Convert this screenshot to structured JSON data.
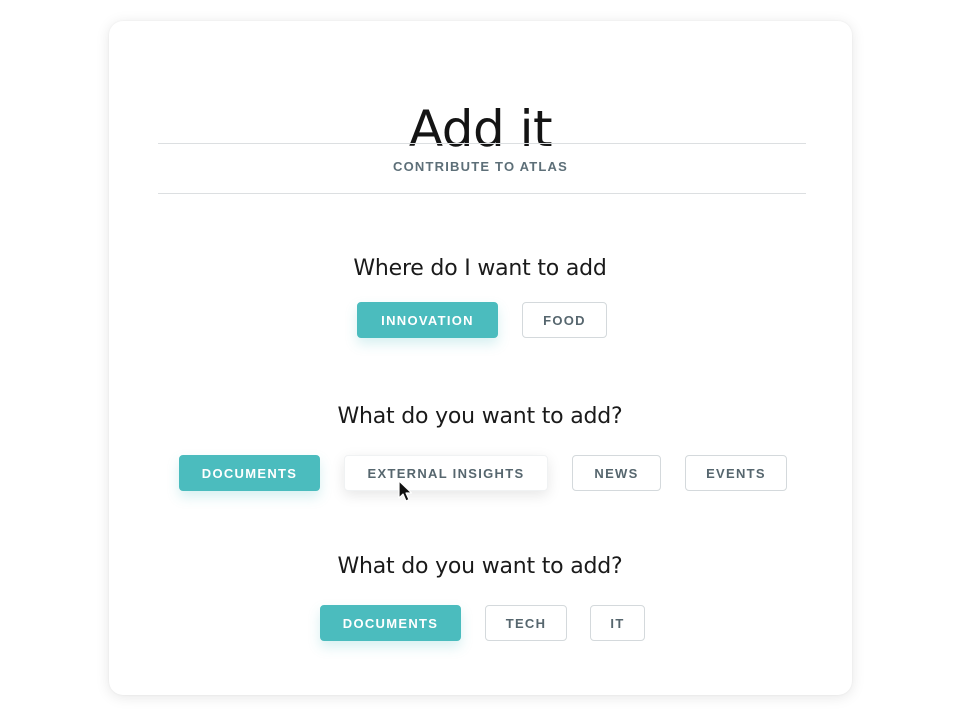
{
  "header": {
    "title": "Add it",
    "subtitle": "CONTRIBUTE TO ATLAS"
  },
  "sections": [
    {
      "heading": "Where do I want to add",
      "options": [
        {
          "label": "INNOVATION",
          "selected": true
        },
        {
          "label": "FOOD",
          "selected": false
        }
      ]
    },
    {
      "heading": "What do you want to add?",
      "options": [
        {
          "label": "DOCUMENTS",
          "selected": true
        },
        {
          "label": "EXTERNAL INSIGHTS",
          "selected": false,
          "hovered": true
        },
        {
          "label": "NEWS",
          "selected": false
        },
        {
          "label": "EVENTS",
          "selected": false
        }
      ]
    },
    {
      "heading": "What do you want to add?",
      "options": [
        {
          "label": "DOCUMENTS",
          "selected": true
        },
        {
          "label": "TECH",
          "selected": false
        },
        {
          "label": "IT",
          "selected": false
        }
      ]
    }
  ],
  "colors": {
    "accent": "#4bbcbe",
    "muted_text": "#5d6f78",
    "border": "#d4d9dc"
  },
  "icons": {
    "cursor": "mouse-pointer-icon"
  }
}
